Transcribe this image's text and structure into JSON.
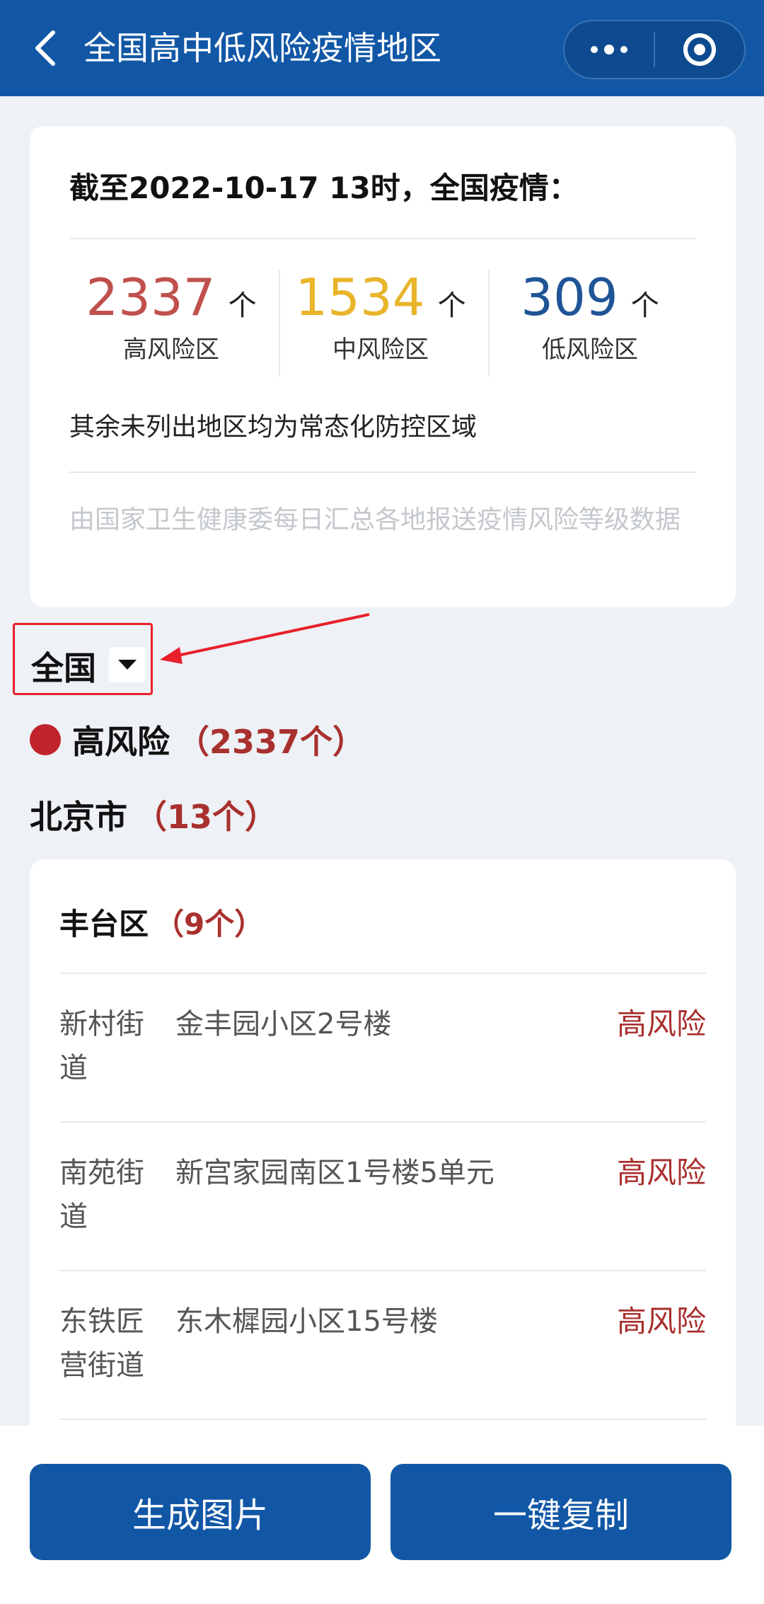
{
  "header": {
    "title": "全国高中低风险疫情地区",
    "back_icon": "chevron-left-icon",
    "more_icon": "more-dots-icon",
    "close_icon": "target-close-icon"
  },
  "summary": {
    "heading": "截至2022-10-17 13时，全国疫情：",
    "stats": [
      {
        "value": "2337",
        "unit": "个",
        "label": "高风险区",
        "color": "#c0504d"
      },
      {
        "value": "1534",
        "unit": "个",
        "label": "中风险区",
        "color": "#e8b52a"
      },
      {
        "value": "309",
        "unit": "个",
        "label": "低风险区",
        "color": "#1f5596"
      }
    ],
    "note": "其余未列出地区均为常态化防控区域",
    "source": "由国家卫生健康委每日汇总各地报送疫情风险等级数据"
  },
  "scope": {
    "selected": "全国"
  },
  "risk_section": {
    "title": "高风险",
    "count": "（2337个）"
  },
  "city": {
    "name": "北京市",
    "count": "（13个）"
  },
  "district": {
    "name": "丰台区",
    "count": "（9个）",
    "rows": [
      {
        "street": "新村街道",
        "place": "金丰园小区2号楼",
        "level": "高风险"
      },
      {
        "street": "南苑街道",
        "place": "新宫家园南区1号楼5单元",
        "level": "高风险"
      },
      {
        "street": "东铁匠营街道",
        "place": "东木樨园小区15号楼",
        "level": "高风险"
      }
    ]
  },
  "actions": {
    "generate_image": "生成图片",
    "copy_all": "一键复制"
  },
  "colors": {
    "brand": "#1157a6",
    "high_risk": "#a8302e",
    "annotation": "#e8202a"
  }
}
